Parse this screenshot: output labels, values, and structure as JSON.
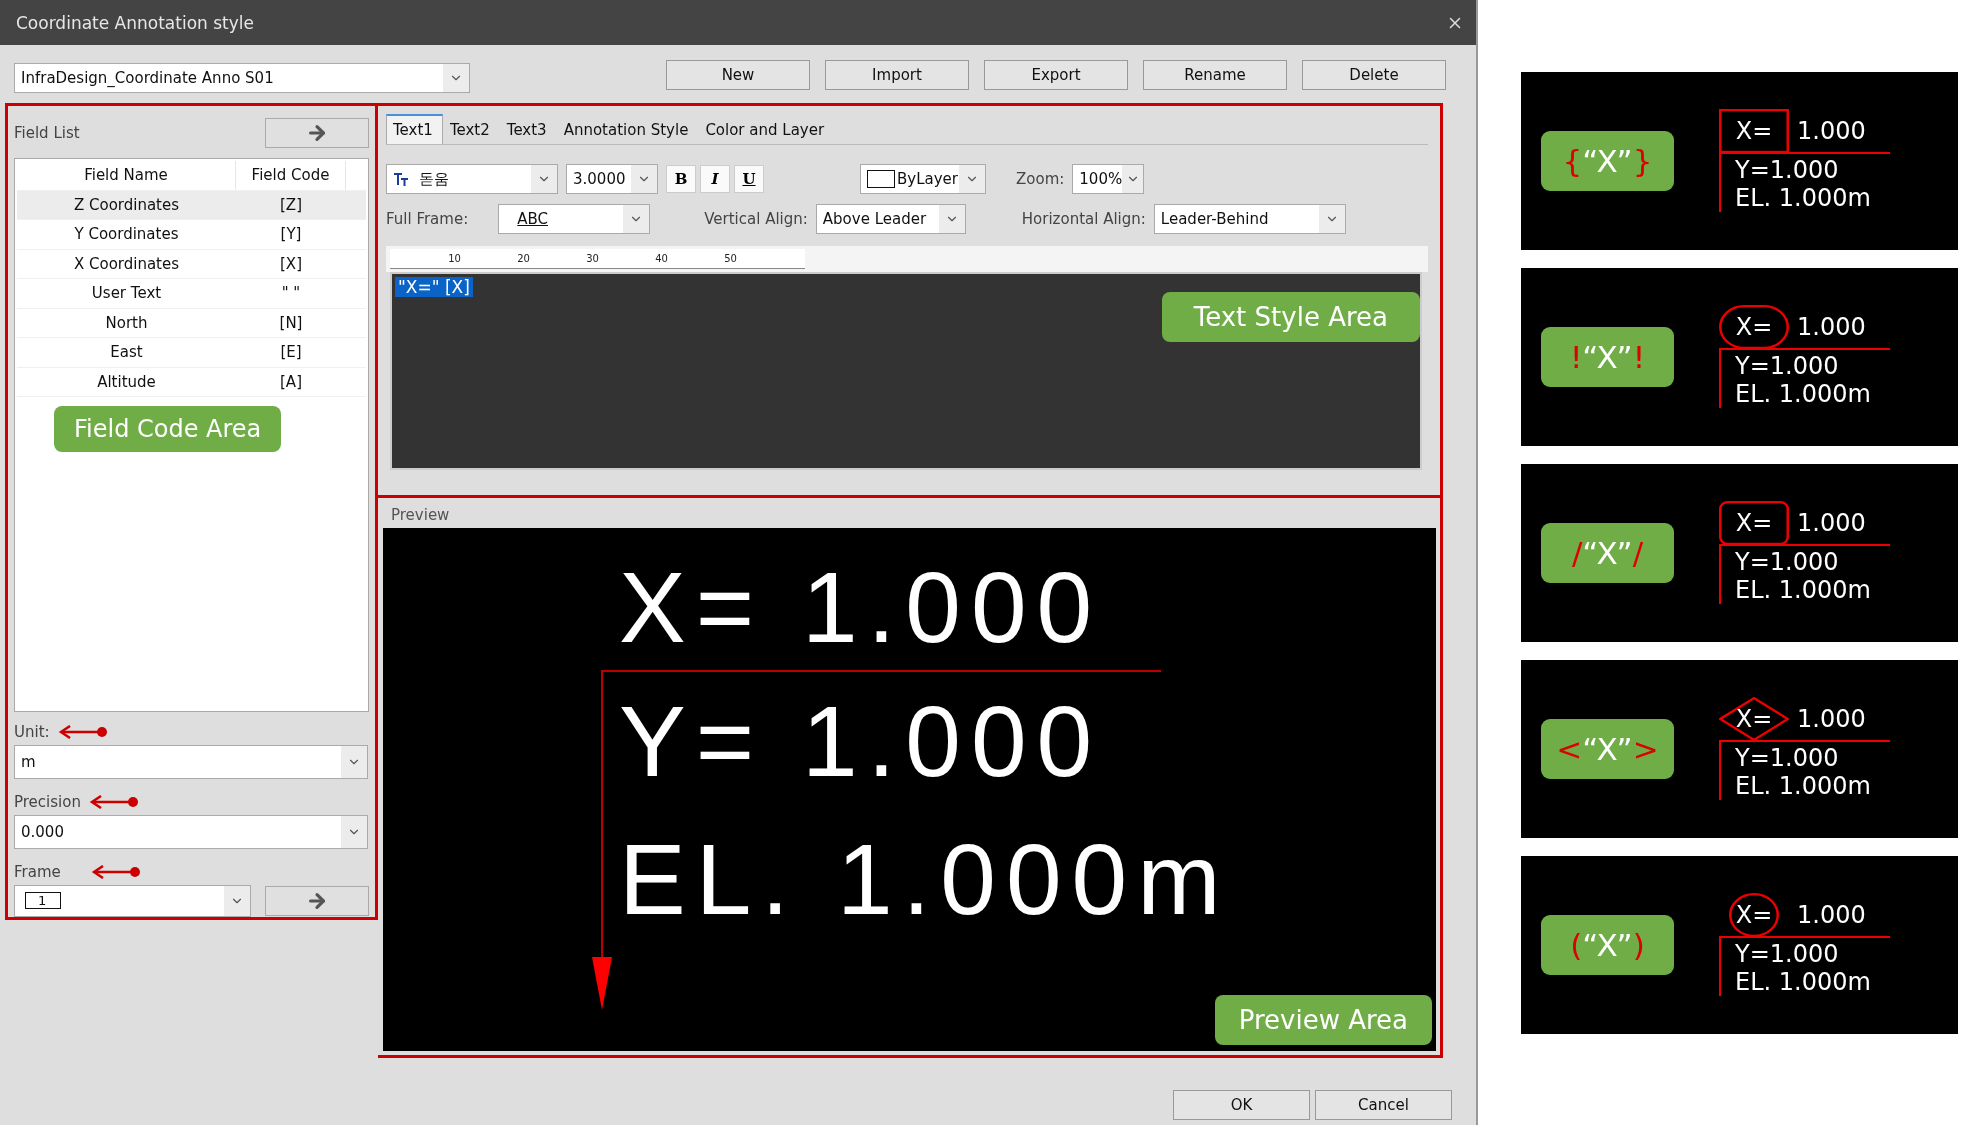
{
  "window": {
    "title": "Coordinate Annotation style"
  },
  "style_select": {
    "value": "InfraDesign_Coordinate Anno S01"
  },
  "buttons": [
    "New",
    "Import",
    "Export",
    "Rename",
    "Delete"
  ],
  "field_list": {
    "title": "Field List",
    "columns": [
      "Field Name",
      "Field Code"
    ],
    "rows": [
      {
        "name": "Z Coordinates",
        "code": "[Z]",
        "selected": true
      },
      {
        "name": "Y Coordinates",
        "code": "[Y]",
        "selected": false
      },
      {
        "name": "X Coordinates",
        "code": "[X]",
        "selected": false
      },
      {
        "name": "User Text",
        "code": "\" \"",
        "selected": false
      },
      {
        "name": "North",
        "code": "[N]",
        "selected": false
      },
      {
        "name": "East",
        "code": "[E]",
        "selected": false
      },
      {
        "name": "Altitude",
        "code": "[A]",
        "selected": false
      }
    ],
    "callout": "Field Code Area"
  },
  "unit": {
    "label": "Unit:",
    "value": "m"
  },
  "precision": {
    "label": "Precision",
    "value": "0.000"
  },
  "frame": {
    "label": "Frame",
    "value": "1"
  },
  "tabs": [
    {
      "label": "Text1",
      "selected": true
    },
    {
      "label": "Text2",
      "selected": false
    },
    {
      "label": "Text3",
      "selected": false
    },
    {
      "label": "Annotation Style",
      "selected": false
    },
    {
      "label": "Color and Layer",
      "selected": false
    }
  ],
  "text_style": {
    "font": "돋움",
    "size": "3.0000",
    "format_buttons": [
      "B",
      "I",
      "U"
    ],
    "layer_color": "ByLayer",
    "zoom_label": "Zoom:",
    "zoom": "100%",
    "full_frame_label": "Full Frame:",
    "full_frame": "ABC",
    "vertical_label": "Vertical Align:",
    "vertical": "Above Leader",
    "horizontal_label": "Horizontal Align:",
    "horizontal": "Leader-Behind",
    "ruler_ticks": [
      "10",
      "20",
      "30",
      "40",
      "50"
    ],
    "editor_text": "\"X=\" [X]",
    "callout": "Text Style Area"
  },
  "preview": {
    "label": "Preview",
    "lines": [
      "X= 1.000",
      "Y= 1.000",
      "EL. 1.000m"
    ],
    "callout": "Preview Area"
  },
  "footer_buttons": [
    "OK",
    "Cancel"
  ],
  "examples": [
    {
      "kind": "rect",
      "open": "{",
      "code": "“X”",
      "close": "}",
      "label": "X=",
      "value": "1.000",
      "y": "Y=1.000",
      "el": "EL. 1.000m"
    },
    {
      "kind": "stadium",
      "open": "!",
      "code": "“X”",
      "close": "!",
      "label": "X=",
      "value": "1.000",
      "y": "Y=1.000",
      "el": "EL. 1.000m"
    },
    {
      "kind": "rounded",
      "open": "/",
      "code": "“X”",
      "close": "/",
      "label": "X=",
      "value": "1.000",
      "y": "Y=1.000",
      "el": "EL. 1.000m"
    },
    {
      "kind": "diamond",
      "open": "<",
      "code": "“X”",
      "close": ">",
      "label": "X=",
      "value": "1.000",
      "y": "Y=1.000",
      "el": "EL. 1.000m"
    },
    {
      "kind": "circle",
      "open": "(",
      "code": "“X”",
      "close": ")",
      "label": "X=",
      "value": "1.000",
      "y": "Y=1.000",
      "el": "EL. 1.000m"
    }
  ]
}
